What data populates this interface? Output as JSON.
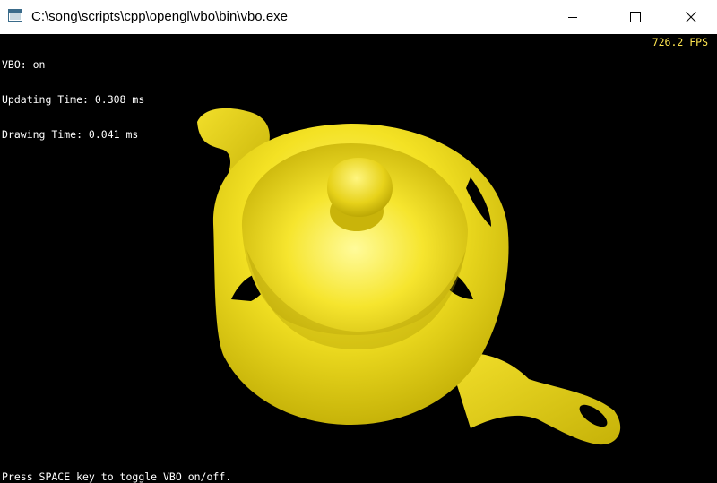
{
  "window": {
    "title": "C:\\song\\scripts\\cpp\\opengl\\vbo\\bin\\vbo.exe",
    "buttons": {
      "minimize": "minimize-icon",
      "maximize": "maximize-icon",
      "close": "close-icon"
    }
  },
  "hud": {
    "vbo_status": "VBO: on",
    "updating_time": "Updating Time: 0.308 ms",
    "drawing_time": "Drawing Time: 0.041 ms",
    "fps": "726.2 FPS",
    "hint": "Press SPACE key to toggle VBO on/off."
  },
  "colors": {
    "background": "#000000",
    "teapot": "#ffe21f",
    "fps_text": "#ffe650",
    "hud_text": "#ffffff"
  }
}
